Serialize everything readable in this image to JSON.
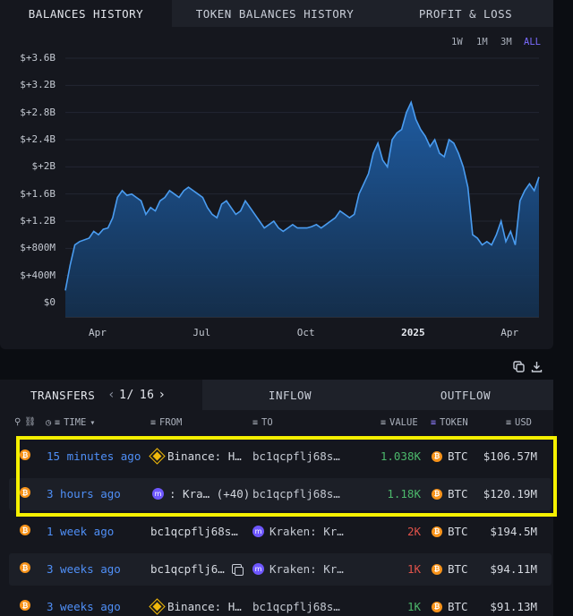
{
  "top_tabs": [
    "BALANCES HISTORY",
    "TOKEN BALANCES HISTORY",
    "PROFIT & LOSS"
  ],
  "ranges": [
    {
      "label": "1W",
      "selected": false
    },
    {
      "label": "1M",
      "selected": false
    },
    {
      "label": "3M",
      "selected": false
    },
    {
      "label": "ALL",
      "selected": true
    }
  ],
  "chart_data": {
    "type": "area",
    "y_tick_labels": [
      "$+3.6B",
      "$+3.2B",
      "$+2.8B",
      "$+2.4B",
      "$+2B",
      "$+1.6B",
      "$+1.2B",
      "$+800M",
      "$+400M",
      "$0"
    ],
    "y_ticks": [
      3.6,
      3.2,
      2.8,
      2.4,
      2.0,
      1.6,
      1.2,
      0.8,
      0.4,
      0
    ],
    "ylim": [
      0,
      3.6
    ],
    "y_unit": "billion USD",
    "x_tick_labels": [
      "Apr",
      "Jul",
      "Oct",
      "2025",
      "Apr"
    ],
    "x_ticks": [
      0.07,
      0.29,
      0.51,
      0.73,
      0.94
    ],
    "xlim": [
      0,
      1
    ],
    "series": [
      {
        "x": [
          0.0,
          0.01,
          0.02,
          0.03,
          0.05,
          0.06,
          0.07,
          0.08,
          0.09,
          0.1,
          0.11,
          0.12,
          0.13,
          0.14,
          0.15,
          0.16,
          0.17,
          0.18,
          0.19,
          0.2,
          0.21,
          0.22,
          0.23,
          0.24,
          0.25,
          0.26,
          0.27,
          0.28,
          0.29,
          0.3,
          0.31,
          0.32,
          0.33,
          0.34,
          0.35,
          0.36,
          0.37,
          0.38,
          0.39,
          0.4,
          0.41,
          0.42,
          0.43,
          0.44,
          0.45,
          0.46,
          0.47,
          0.48,
          0.49,
          0.5,
          0.51,
          0.52,
          0.53,
          0.54,
          0.55,
          0.56,
          0.57,
          0.58,
          0.59,
          0.6,
          0.61,
          0.62,
          0.63,
          0.64,
          0.65,
          0.66,
          0.67,
          0.68,
          0.69,
          0.7,
          0.71,
          0.72,
          0.73,
          0.74,
          0.75,
          0.76,
          0.77,
          0.78,
          0.79,
          0.8,
          0.81,
          0.82,
          0.83,
          0.84,
          0.85,
          0.86,
          0.87,
          0.88,
          0.89,
          0.9,
          0.91,
          0.92,
          0.93,
          0.94,
          0.95,
          0.96,
          0.97,
          0.98,
          0.99,
          1.0
        ],
        "y": [
          0.18,
          0.55,
          0.85,
          0.9,
          0.95,
          1.05,
          1.0,
          1.08,
          1.1,
          1.25,
          1.55,
          1.65,
          1.58,
          1.6,
          1.55,
          1.5,
          1.3,
          1.4,
          1.35,
          1.5,
          1.55,
          1.65,
          1.6,
          1.55,
          1.65,
          1.7,
          1.65,
          1.6,
          1.55,
          1.4,
          1.3,
          1.25,
          1.45,
          1.5,
          1.4,
          1.3,
          1.35,
          1.5,
          1.4,
          1.3,
          1.2,
          1.1,
          1.15,
          1.2,
          1.1,
          1.05,
          1.1,
          1.15,
          1.1,
          1.1,
          1.1,
          1.12,
          1.15,
          1.1,
          1.15,
          1.2,
          1.25,
          1.35,
          1.3,
          1.25,
          1.3,
          1.6,
          1.75,
          1.9,
          2.2,
          2.35,
          2.1,
          2.0,
          2.4,
          2.5,
          2.55,
          2.8,
          2.95,
          2.7,
          2.55,
          2.45,
          2.3,
          2.4,
          2.2,
          2.15,
          2.4,
          2.35,
          2.2,
          2.0,
          1.7,
          1.0,
          0.95,
          0.85,
          0.9,
          0.85,
          1.0,
          1.2,
          0.9,
          1.05,
          0.85,
          1.5,
          1.65,
          1.75,
          1.65,
          1.85
        ]
      }
    ]
  },
  "transfers": {
    "tab_label": "TRANSFERS",
    "page": "1/",
    "pages": "16",
    "inflow_label": "INFLOW",
    "outflow_label": "OUTFLOW",
    "headers": {
      "time": "TIME",
      "from": "FROM",
      "to": "TO",
      "value": "VALUE",
      "token": "TOKEN",
      "usd": "USD"
    },
    "rows": [
      {
        "time": "15 minutes ago",
        "from": "Binance: H…",
        "from_entity": "binance",
        "to": "bc1qcpflj68s…",
        "to_entity": "",
        "value": "1.038K",
        "direction": "in",
        "token": "BTC",
        "usd": "$106.57M"
      },
      {
        "time": "3 hours ago",
        "from": ": Kra… (+40)",
        "from_entity": "kraken",
        "to": "bc1qcpflj68s…",
        "to_entity": "",
        "value": "1.18K",
        "direction": "in",
        "token": "BTC",
        "usd": "$120.19M"
      },
      {
        "time": "1 week ago",
        "from": "bc1qcpflj68s…",
        "from_entity": "",
        "to": "Kraken: Kr…",
        "to_entity": "kraken",
        "value": "2K",
        "direction": "out",
        "token": "BTC",
        "usd": "$194.5M"
      },
      {
        "time": "3 weeks ago",
        "from": "bc1qcpflj6…",
        "from_entity": "",
        "to": "Kraken: Kr…",
        "to_entity": "kraken",
        "value": "1K",
        "direction": "out",
        "token": "BTC",
        "usd": "$94.11M"
      },
      {
        "time": "3 weeks ago",
        "from": "Binance: H…",
        "from_entity": "binance",
        "to": "bc1qcpflj68s…",
        "to_entity": "",
        "value": "1K",
        "direction": "in",
        "token": "BTC",
        "usd": "$91.13M"
      }
    ]
  },
  "colors": {
    "accent": "#7b6cff",
    "btc": "#f7931a",
    "inflow": "#4cb86b",
    "outflow": "#e0524a",
    "link": "#4f8ff7",
    "highlight": "#f5f000"
  },
  "icons": [
    "filter-icon",
    "link-icon",
    "clock-icon",
    "copy-icon",
    "download-icon",
    "binance-icon",
    "kraken-icon",
    "bitcoin-icon"
  ]
}
